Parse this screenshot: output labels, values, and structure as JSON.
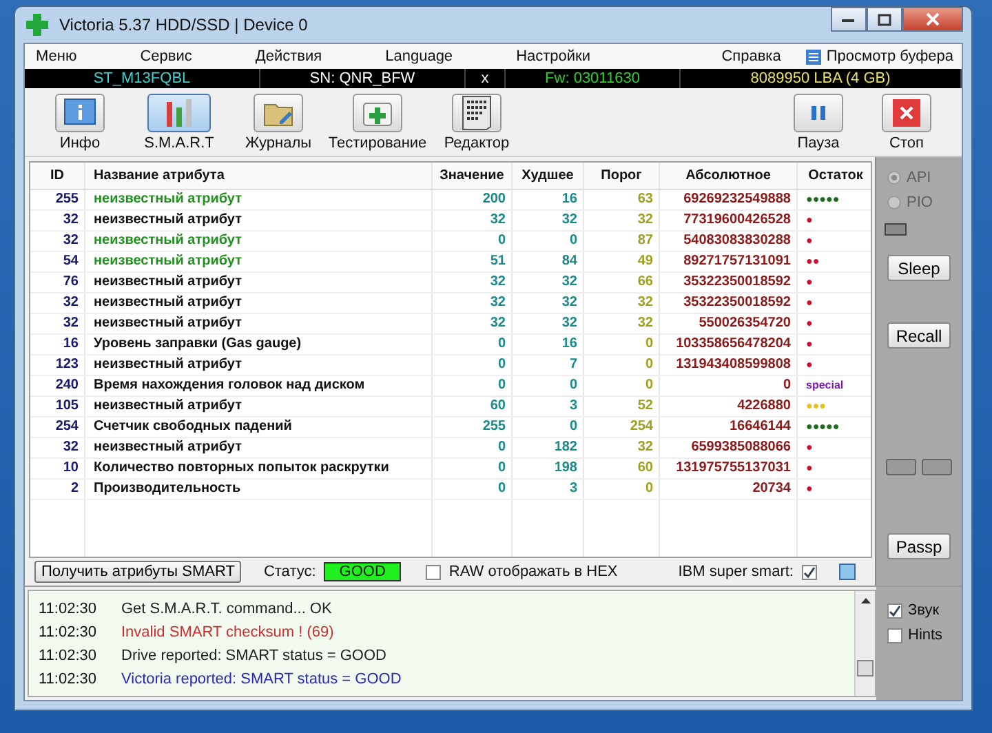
{
  "window": {
    "title": "Victoria 5.37 HDD/SSD | Device 0"
  },
  "menu": [
    {
      "label": "Меню"
    },
    {
      "label": "Сервис"
    },
    {
      "label": "Действия"
    },
    {
      "label": "Language"
    },
    {
      "label": "Настройки"
    },
    {
      "label": "Справка"
    }
  ],
  "buffer_view": {
    "label": "Просмотр буфера"
  },
  "device_bar": {
    "model": "ST_M13FQBL",
    "serial": "SN: QNR_BFW",
    "close": "x",
    "firmware": "Fw: 03011630",
    "capacity": "8089950 LBA (4 GB)"
  },
  "toolbar": [
    {
      "label": "Инфо",
      "kind": "info",
      "selected": false
    },
    {
      "label": "S.M.A.R.T",
      "kind": "smart",
      "selected": true
    },
    {
      "label": "Журналы",
      "kind": "logs",
      "selected": false
    },
    {
      "label": "Тестирование",
      "kind": "test",
      "selected": false
    },
    {
      "label": "Редактор",
      "kind": "editor",
      "selected": false
    }
  ],
  "toolbar_right": [
    {
      "label": "Пауза",
      "kind": "pause"
    },
    {
      "label": "Стоп",
      "kind": "stop"
    }
  ],
  "table": {
    "columns": [
      "ID",
      "Название атрибута",
      "Значение",
      "Худшее",
      "Порог",
      "Абсолютное",
      "Остаток"
    ],
    "rows": [
      {
        "id": "255",
        "name": "неизвестный атрибут",
        "highlight": true,
        "value": "200",
        "worst": "16",
        "threshold": "63",
        "raw": "69269232549888",
        "remaining": "●●●●●",
        "color": "#1d6b1d"
      },
      {
        "id": "32",
        "name": "неизвестный атрибут",
        "highlight": false,
        "value": "32",
        "worst": "32",
        "threshold": "32",
        "raw": "77319600426528",
        "remaining": "●",
        "color": "#d01030"
      },
      {
        "id": "32",
        "name": "неизвестный атрибут",
        "highlight": true,
        "value": "0",
        "worst": "0",
        "threshold": "87",
        "raw": "54083083830288",
        "remaining": "●",
        "color": "#d01030"
      },
      {
        "id": "54",
        "name": "неизвестный атрибут",
        "highlight": true,
        "value": "51",
        "worst": "84",
        "threshold": "49",
        "raw": "89271757131091",
        "remaining": "●●",
        "color": "#d01030"
      },
      {
        "id": "76",
        "name": "неизвестный атрибут",
        "highlight": false,
        "value": "32",
        "worst": "32",
        "threshold": "66",
        "raw": "35322350018592",
        "remaining": "●",
        "color": "#d01030"
      },
      {
        "id": "32",
        "name": "неизвестный атрибут",
        "highlight": false,
        "value": "32",
        "worst": "32",
        "threshold": "32",
        "raw": "35322350018592",
        "remaining": "●",
        "color": "#d01030"
      },
      {
        "id": "32",
        "name": "неизвестный атрибут",
        "highlight": false,
        "value": "32",
        "worst": "32",
        "threshold": "32",
        "raw": "550026354720",
        "remaining": "●",
        "color": "#d01030"
      },
      {
        "id": "16",
        "name": "Уровень заправки (Gas gauge)",
        "highlight": false,
        "value": "0",
        "worst": "16",
        "threshold": "0",
        "raw": "103358656478204",
        "remaining": "●",
        "color": "#d01030"
      },
      {
        "id": "123",
        "name": "неизвестный атрибут",
        "highlight": false,
        "value": "0",
        "worst": "7",
        "threshold": "0",
        "raw": "131943408599808",
        "remaining": "●",
        "color": "#d01030"
      },
      {
        "id": "240",
        "name": "Время нахождения головок над диском",
        "highlight": false,
        "value": "0",
        "worst": "0",
        "threshold": "0",
        "raw": "0",
        "remaining": "special",
        "color": "#7a1ab8"
      },
      {
        "id": "105",
        "name": "неизвестный атрибут",
        "highlight": false,
        "value": "60",
        "worst": "3",
        "threshold": "52",
        "raw": "4226880",
        "remaining": "●●●",
        "color": "#e8c020"
      },
      {
        "id": "254",
        "name": "Счетчик свободных падений",
        "highlight": false,
        "value": "255",
        "worst": "0",
        "threshold": "254",
        "raw": "16646144",
        "remaining": "●●●●●",
        "color": "#1d6b1d"
      },
      {
        "id": "32",
        "name": "неизвестный атрибут",
        "highlight": false,
        "value": "0",
        "worst": "182",
        "threshold": "32",
        "raw": "6599385088066",
        "remaining": "●",
        "color": "#d01030"
      },
      {
        "id": "10",
        "name": "Количество повторных попыток раскрутки",
        "highlight": false,
        "value": "0",
        "worst": "198",
        "threshold": "60",
        "raw": "131975755137031",
        "remaining": "●",
        "color": "#d01030"
      },
      {
        "id": "2",
        "name": "Производительность",
        "highlight": false,
        "value": "0",
        "worst": "3",
        "threshold": "0",
        "raw": "20734",
        "remaining": "●",
        "color": "#d01030"
      }
    ]
  },
  "side_panel": {
    "modes": [
      {
        "label": "API",
        "selected": true,
        "disabled": true
      },
      {
        "label": "PIO",
        "selected": false,
        "disabled": true
      }
    ],
    "buttons": [
      {
        "label": "Sleep"
      },
      {
        "label": "Recall"
      },
      {
        "label": "Passp"
      }
    ]
  },
  "status_bar": {
    "get_button": "Получить атрибуты SMART",
    "status_label": "Статус:",
    "status": "GOOD",
    "raw_hex": {
      "label": "RAW отображать в HEX",
      "checked": false
    },
    "ibm": {
      "label": "IBM super smart:",
      "checked": true
    }
  },
  "log": [
    {
      "time": "11:02:30",
      "text": "Get S.M.A.R.T. command... OK",
      "color": "#202020"
    },
    {
      "time": "11:02:30",
      "text": "Invalid SMART checksum ! (69)",
      "color": "#c83030"
    },
    {
      "time": "11:02:30",
      "text": "Drive reported: SMART status = GOOD",
      "color": "#202020"
    },
    {
      "time": "11:02:30",
      "text": "Victoria reported: SMART status = GOOD",
      "color": "#2828b0"
    }
  ],
  "log_options": [
    {
      "label": "Звук",
      "checked": true
    },
    {
      "label": "Hints",
      "checked": false
    }
  ]
}
